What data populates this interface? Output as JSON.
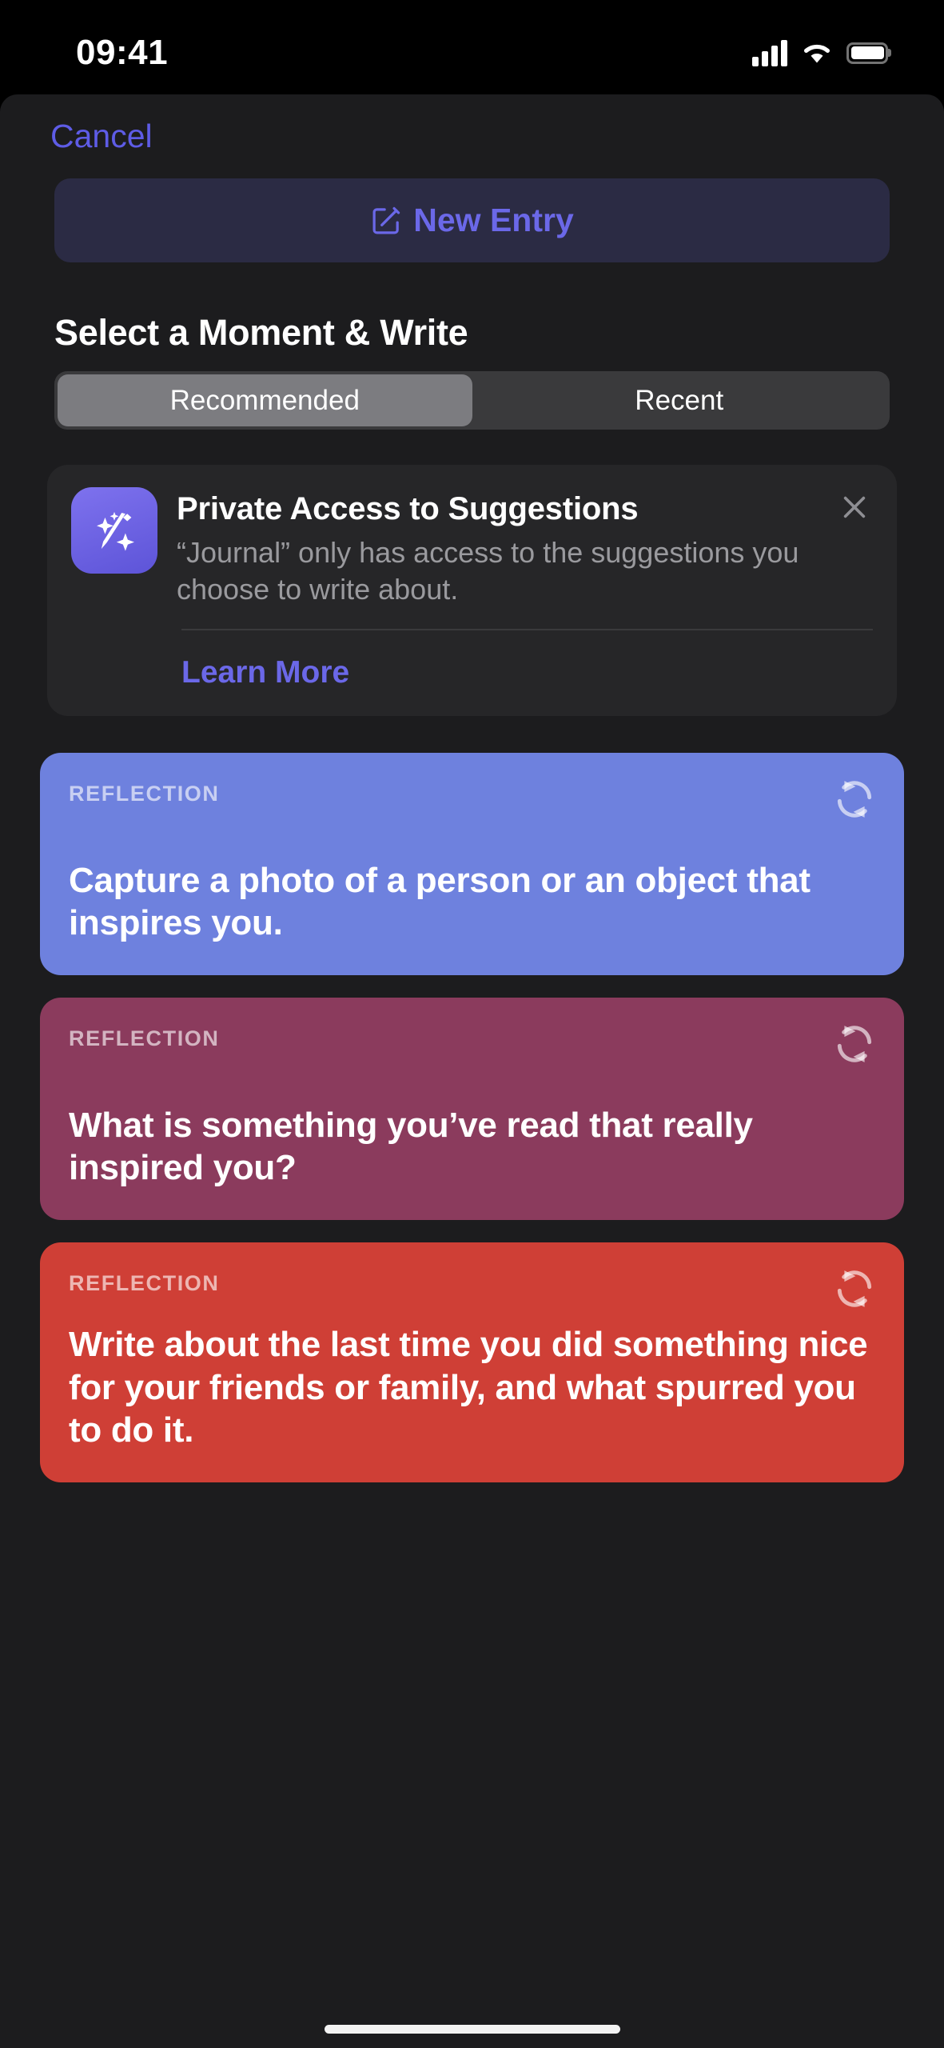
{
  "status_bar": {
    "time": "09:41",
    "icons": [
      "cellular-signal-icon",
      "wifi-icon",
      "battery-icon"
    ]
  },
  "nav": {
    "cancel_label": "Cancel"
  },
  "new_entry": {
    "label": "New Entry",
    "icon": "compose-icon"
  },
  "heading": "Select a Moment & Write",
  "segmented_control": {
    "selected": "Recommended",
    "options": [
      {
        "label": "Recommended",
        "selected": true
      },
      {
        "label": "Recent",
        "selected": false
      }
    ]
  },
  "privacy_card": {
    "icon": "magic-wand-icon",
    "title": "Private Access to Suggestions",
    "body": "“Journal” only has access to the suggestions you choose to write about.",
    "learn_more_label": "Learn More",
    "close_icon": "close-icon"
  },
  "colors": {
    "accent": "#5E5CE6",
    "link": "#6B68E8",
    "sheet_bg": "#1C1C1E",
    "card_bg": "#262628",
    "card_blue": "#6E81DE",
    "card_maroon": "#8B3B5D",
    "card_red": "#CF3F36"
  },
  "reflection_cards": [
    {
      "kicker": "REFLECTION",
      "prompt": "Capture a photo of a person or an object that inspires you.",
      "color": "#6E81DE",
      "refresh_icon": "refresh-icon"
    },
    {
      "kicker": "REFLECTION",
      "prompt": "What is something you’ve read that really inspired you?",
      "color": "#8B3B5D",
      "refresh_icon": "refresh-icon"
    },
    {
      "kicker": "REFLECTION",
      "prompt": "Write about the last time you did something nice for your friends or family, and what spurred you to do it.",
      "color": "#CF3F36",
      "refresh_icon": "refresh-icon"
    }
  ]
}
